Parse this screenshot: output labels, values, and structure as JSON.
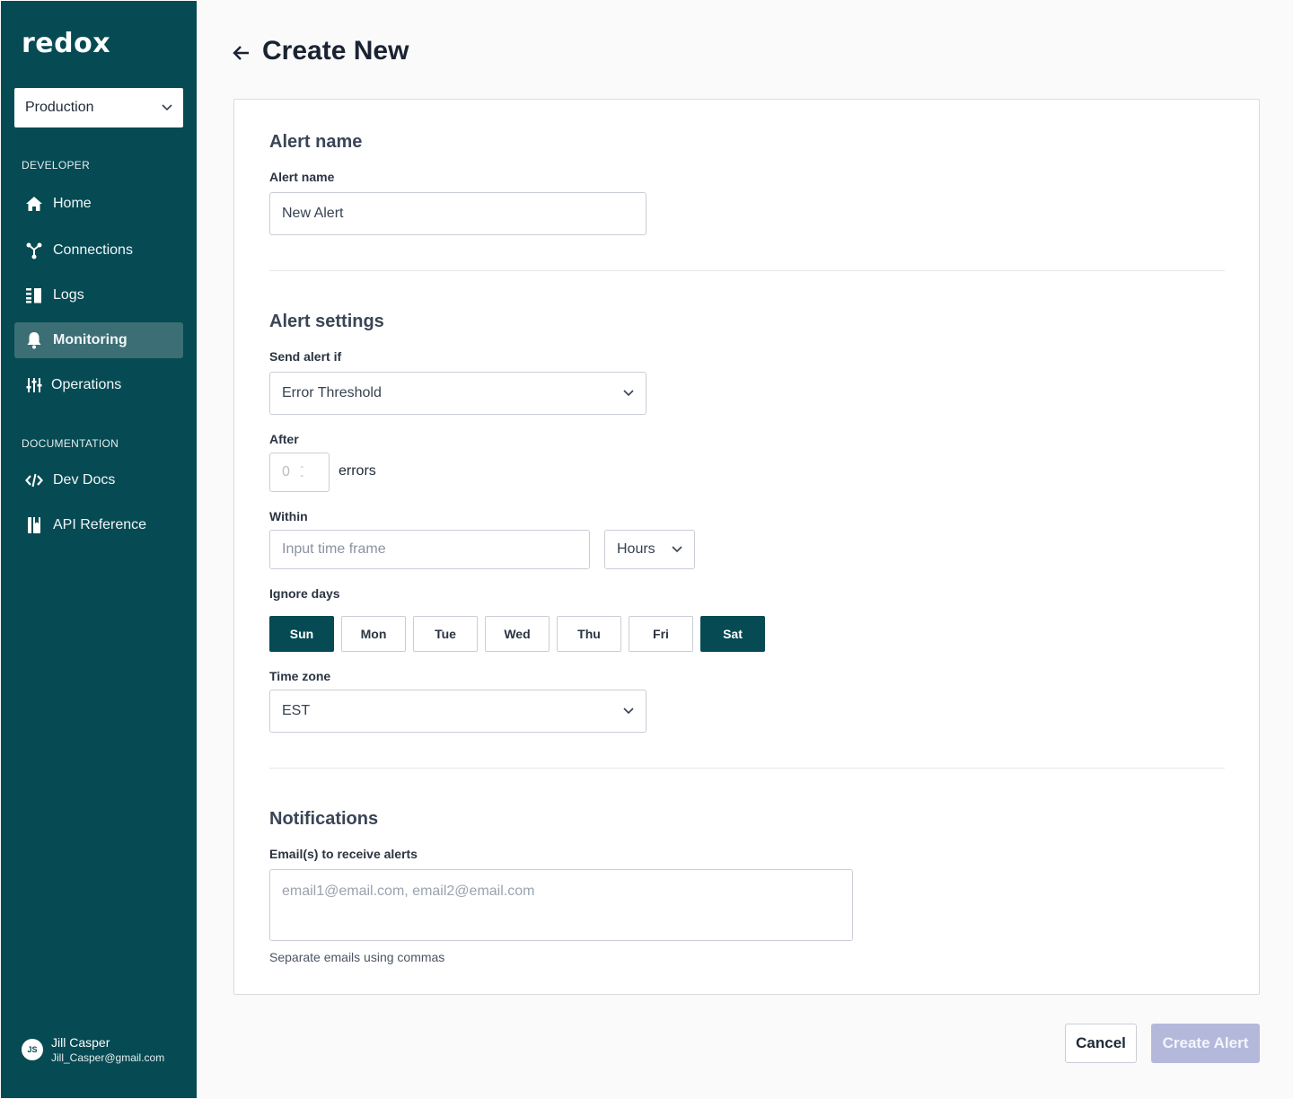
{
  "sidebar": {
    "logo": "redox",
    "environment": "Production",
    "sections": {
      "developer": "DEVELOPER",
      "documentation": "DOCUMENTATION"
    },
    "items": [
      {
        "label": "Home",
        "icon": "home-icon"
      },
      {
        "label": "Connections",
        "icon": "connections-icon"
      },
      {
        "label": "Logs",
        "icon": "logs-icon"
      },
      {
        "label": "Monitoring",
        "icon": "bell-icon",
        "active": true
      },
      {
        "label": "Operations",
        "icon": "sliders-icon"
      },
      {
        "label": "Dev Docs",
        "icon": "code-icon"
      },
      {
        "label": "API Reference",
        "icon": "book-icon"
      }
    ],
    "user": {
      "initials": "JS",
      "name": "Jill Casper",
      "email": "Jill_Casper@gmail.com"
    }
  },
  "header": {
    "title": "Create New"
  },
  "form": {
    "alert_name_section": {
      "heading": "Alert name",
      "label": "Alert name",
      "value": "New Alert"
    },
    "settings_section": {
      "heading": "Alert settings",
      "send_alert_if_label": "Send alert if",
      "send_alert_if_value": "Error Threshold",
      "after_label": "After",
      "after_value": "0",
      "after_unit": "errors",
      "within_label": "Within",
      "within_placeholder": "Input time frame",
      "within_unit": "Hours",
      "ignore_days_label": "Ignore days",
      "days": [
        {
          "label": "Sun",
          "selected": true
        },
        {
          "label": "Mon",
          "selected": false
        },
        {
          "label": "Tue",
          "selected": false
        },
        {
          "label": "Wed",
          "selected": false
        },
        {
          "label": "Thu",
          "selected": false
        },
        {
          "label": "Fri",
          "selected": false
        },
        {
          "label": "Sat",
          "selected": true
        }
      ],
      "timezone_label": "Time zone",
      "timezone_value": "EST"
    },
    "notifications_section": {
      "heading": "Notifications",
      "emails_label": "Email(s) to receive alerts",
      "emails_placeholder": "email1@email.com, email2@email.com",
      "help_text": "Separate emails using commas"
    }
  },
  "actions": {
    "cancel": "Cancel",
    "create": "Create Alert"
  },
  "colors": {
    "sidebar": "#064a53",
    "active_nav": "#3c6e76",
    "selected_day": "#064a53",
    "disabled_primary": "#b4b9dc"
  }
}
